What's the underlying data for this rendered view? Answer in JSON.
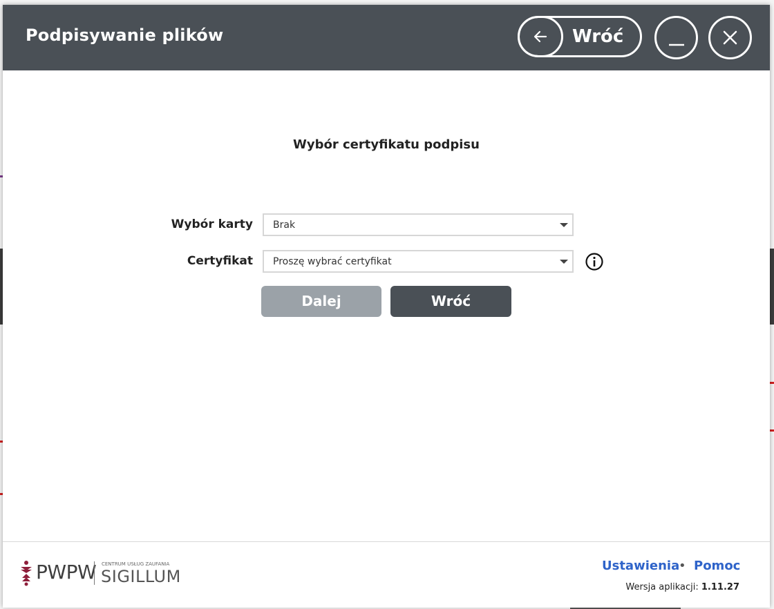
{
  "window": {
    "title": "Podpisywanie plików",
    "back_label": "Wróć"
  },
  "form": {
    "heading": "Wybór certyfikatu podpisu",
    "card_label": "Wybór karty",
    "card_value": "Brak",
    "cert_label": "Certyfikat",
    "cert_value": "Proszę wybrać certyfikat",
    "next_label": "Dalej",
    "back_label": "Wróć"
  },
  "footer": {
    "logo_brand": "PWPW",
    "logo_small": "CENTRUM USŁUG ZAUFANIA",
    "logo_name": "SIGILLUM",
    "settings_label": "Ustawienia",
    "separator": "•",
    "help_label": "Pomoc",
    "version_label": "Wersja aplikacji:",
    "version_value": "1.11.27"
  },
  "colors": {
    "titlebar": "#4a5056",
    "link": "#2e63c9",
    "button_disabled": "#9ba2a8",
    "button_primary": "#4a5056",
    "logo_accent": "#8e1f3b"
  },
  "icons": [
    "back-arrow-icon",
    "minimize-icon",
    "close-icon",
    "info-icon",
    "pwpw-emblem-icon"
  ]
}
